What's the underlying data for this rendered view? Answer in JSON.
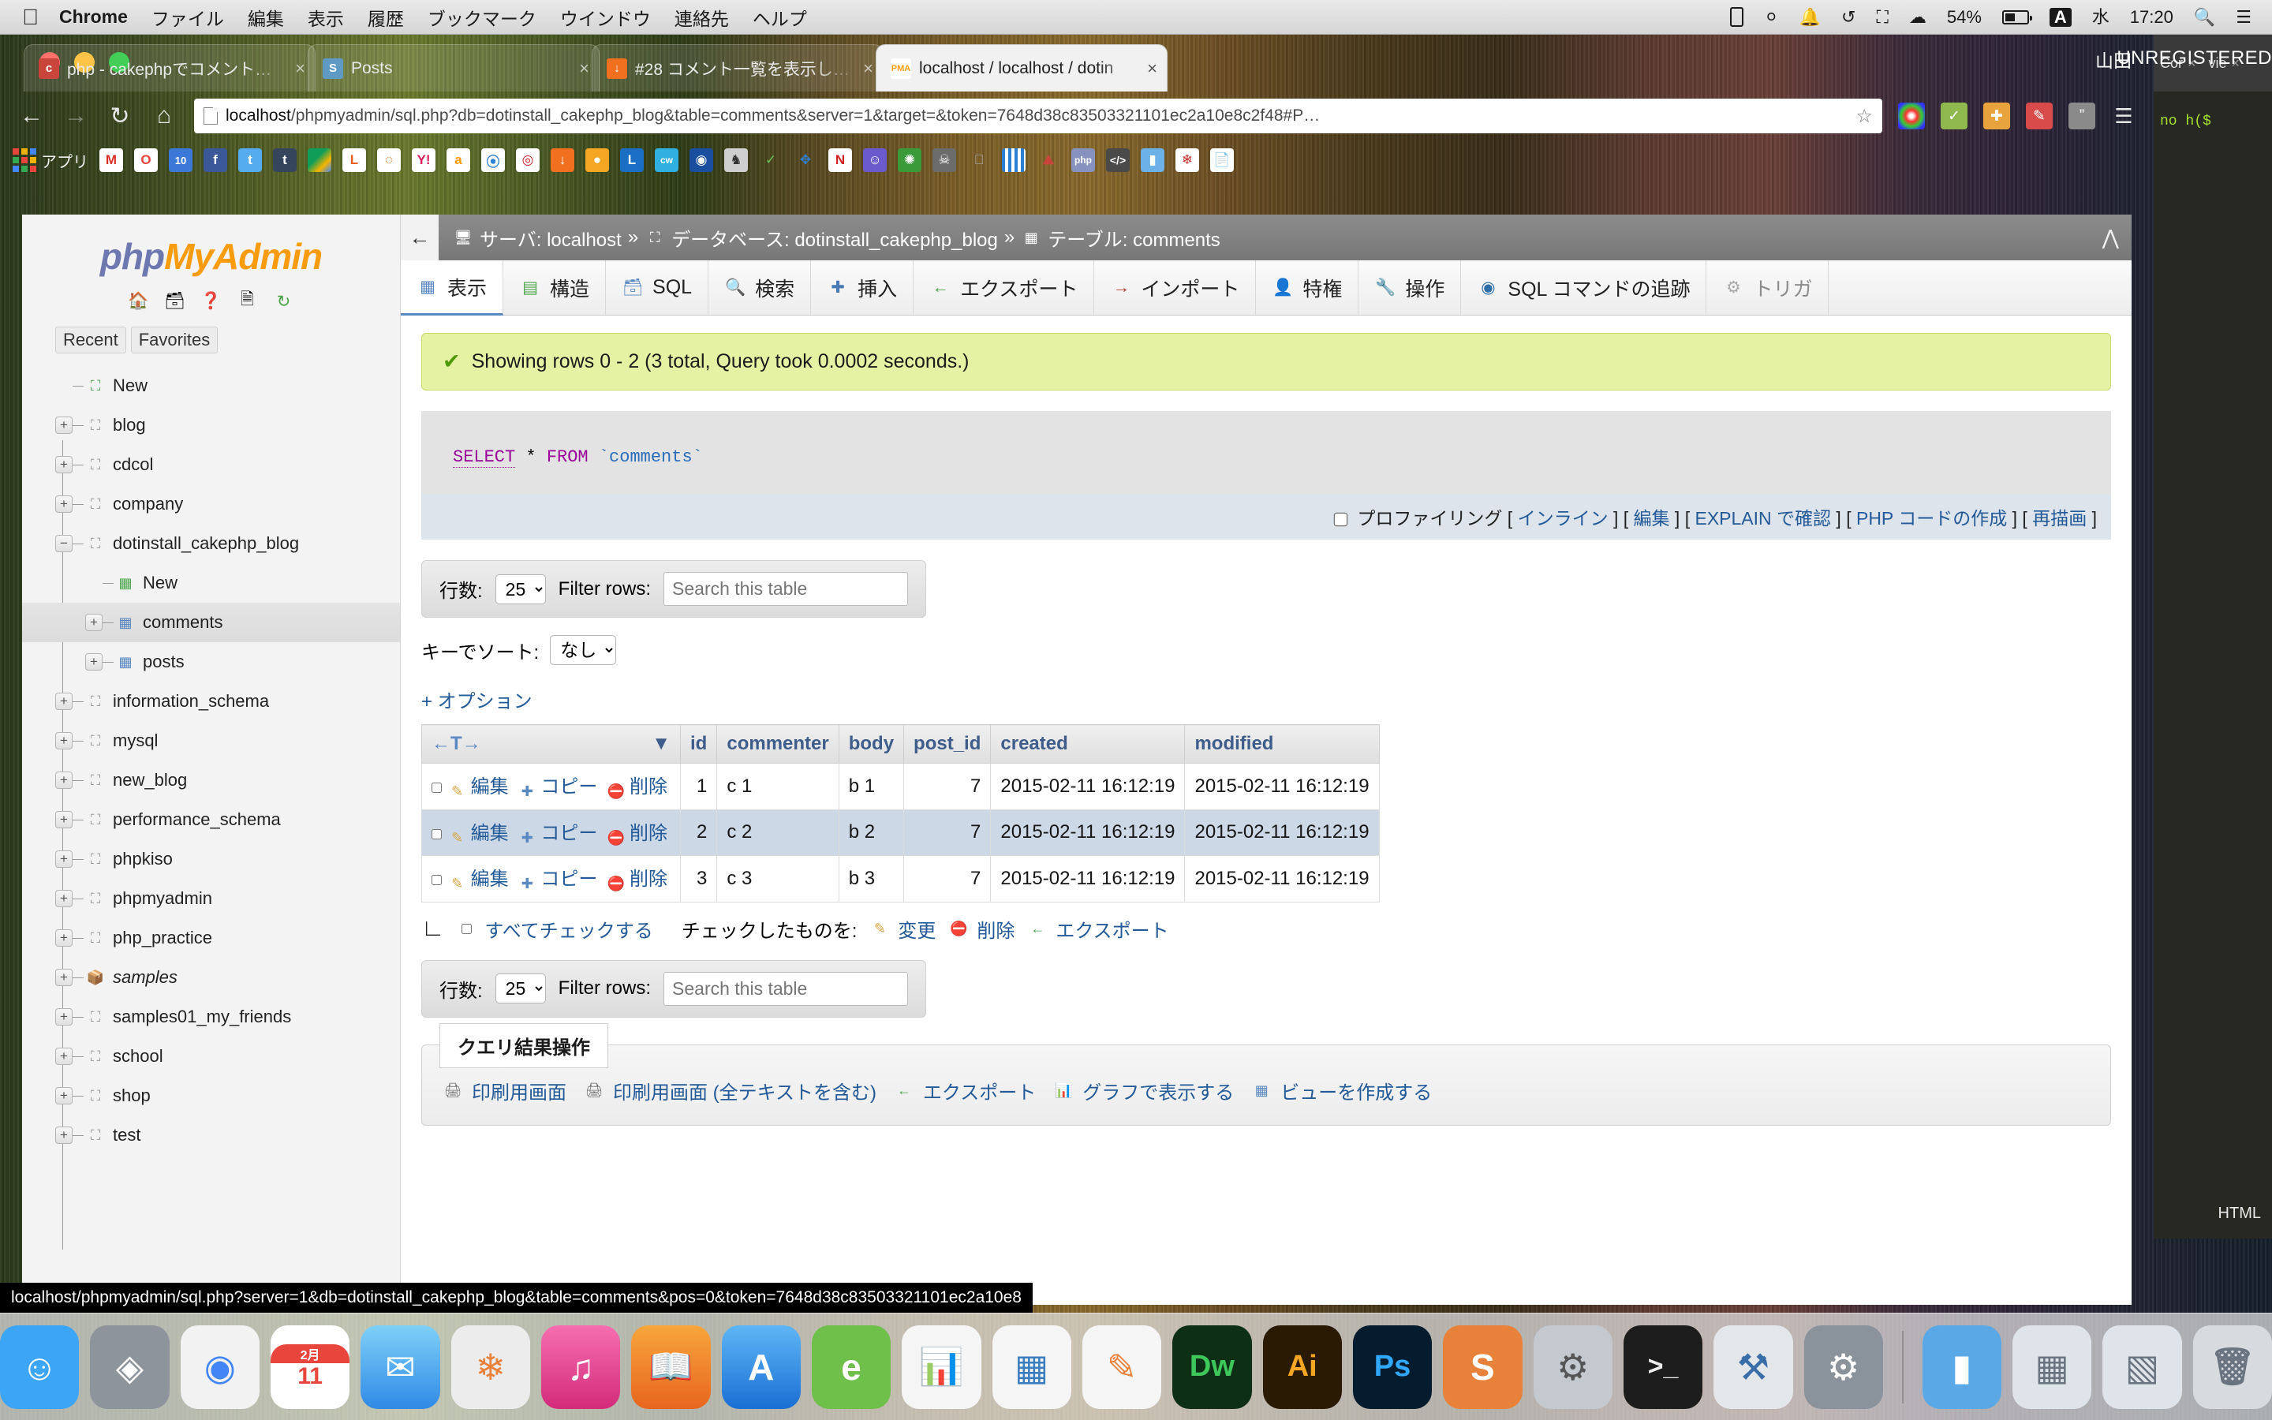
{
  "menubar": {
    "apple": "apple-logo",
    "items": [
      {
        "label": "Chrome",
        "bold": true
      },
      {
        "label": "ファイル",
        "bold": false
      },
      {
        "label": "編集",
        "bold": false
      },
      {
        "label": "表示",
        "bold": false
      },
      {
        "label": "履歴",
        "bold": false
      },
      {
        "label": "ブックマーク",
        "bold": false
      },
      {
        "label": "ウインドウ",
        "bold": false
      },
      {
        "label": "連絡先",
        "bold": false
      },
      {
        "label": "ヘルプ",
        "bold": false
      }
    ],
    "status": {
      "battery_percent": "54%",
      "input_source": "A",
      "day": "水",
      "time": "17:20"
    }
  },
  "browser": {
    "tabs": [
      {
        "title": "php - cakephpでコメント…",
        "favicon": "cakephp-icon",
        "active": false
      },
      {
        "title": "Posts",
        "favicon": "posts-icon",
        "active": false
      },
      {
        "title": "#28 コメント一覧を表示し…",
        "favicon": "dotinstall-icon",
        "active": false
      },
      {
        "title": "localhost / localhost / dotin",
        "favicon": "phpmyadmin-icon",
        "active": true
      }
    ],
    "nav": {
      "back": "back-icon",
      "forward": "forward-icon",
      "reload": "reload-icon",
      "home": "home-icon"
    },
    "omnibox": {
      "url_bold": "localhost",
      "url_rest": "/phpmyadmin/sql.php?db=dotinstall_cakephp_blog&table=comments&server=1&target=&token=7648d38c83503321101ec2a10e8c2f48#P…",
      "star": "star-icon"
    },
    "bookmarks": [
      {
        "label": "アプリ",
        "icon": "apps-grid-icon"
      },
      {
        "label": "",
        "icon": "gmail-icon"
      },
      {
        "label": "",
        "icon": "opera-icon"
      },
      {
        "label": "",
        "icon": "calendar-icon"
      },
      {
        "label": "",
        "icon": "facebook-icon"
      },
      {
        "label": "",
        "icon": "twitter-icon"
      },
      {
        "label": "",
        "icon": "tumblr-icon"
      },
      {
        "label": "",
        "icon": "google-drive-icon"
      },
      {
        "label": "",
        "icon": "livedoor-icon"
      },
      {
        "label": "",
        "icon": "firefox-icon"
      },
      {
        "label": "",
        "icon": "yahoo-icon"
      },
      {
        "label": "",
        "icon": "amazon-icon"
      },
      {
        "label": "",
        "icon": "water-icon"
      },
      {
        "label": "",
        "icon": "target-icon"
      },
      {
        "label": "",
        "icon": "download-icon"
      },
      {
        "label": "",
        "icon": "mango-icon"
      },
      {
        "label": "",
        "icon": "l-blue-icon"
      },
      {
        "label": "",
        "icon": "cw-icon"
      },
      {
        "label": "",
        "icon": "blue-circle-icon"
      },
      {
        "label": "",
        "icon": "horse-icon"
      },
      {
        "label": "",
        "icon": "check-icon"
      },
      {
        "label": "",
        "icon": "bluetooth-icon"
      },
      {
        "label": "",
        "icon": "n-icon"
      },
      {
        "label": "",
        "icon": "monkey-icon"
      },
      {
        "label": "",
        "icon": "leaf-icon"
      },
      {
        "label": "",
        "icon": "ghost-icon"
      },
      {
        "label": "",
        "icon": "apple-gray-icon"
      },
      {
        "label": "",
        "icon": "stripes-icon"
      },
      {
        "label": "",
        "icon": "cake-icon"
      },
      {
        "label": "",
        "icon": "php-icon"
      },
      {
        "label": "",
        "icon": "code-icon"
      },
      {
        "label": "",
        "icon": "folder-icon"
      },
      {
        "label": "",
        "icon": "seal-icon"
      },
      {
        "label": "",
        "icon": "doc-icon"
      }
    ],
    "extensions": [
      "color-wheel-icon",
      "check-green-icon",
      "orange-cross-icon",
      "pen-icon",
      "quote-icon",
      "chart-icon",
      "menu-icon"
    ],
    "status_bar_url": "localhost/phpmyadmin/sql.php?server=1&db=dotinstall_cakephp_blog&table=comments&pos=0&token=7648d38c83503321101ec2a10e8"
  },
  "pma": {
    "logo": {
      "part1": "php",
      "part2": "MyAdmin"
    },
    "nav_icons": [
      "home-icon",
      "sql-query-icon",
      "help-icon",
      "docs-icon",
      "reload-nav-icon"
    ],
    "nav_tabs": [
      {
        "label": "Recent"
      },
      {
        "label": "Favorites"
      }
    ],
    "db_tree": [
      {
        "label": "New",
        "expander": "none",
        "icon": "db-new-icon",
        "level": 0,
        "selected": false,
        "italic": false
      },
      {
        "label": "blog",
        "expander": "+",
        "icon": "db-icon",
        "level": 0,
        "selected": false,
        "italic": false
      },
      {
        "label": "cdcol",
        "expander": "+",
        "icon": "db-icon",
        "level": 0,
        "selected": false,
        "italic": false
      },
      {
        "label": "company",
        "expander": "+",
        "icon": "db-icon",
        "level": 0,
        "selected": false,
        "italic": false
      },
      {
        "label": "dotinstall_cakephp_blog",
        "expander": "-",
        "icon": "db-icon",
        "level": 0,
        "selected": false,
        "italic": false
      },
      {
        "label": "New",
        "expander": "none",
        "icon": "table-new-icon",
        "level": 1,
        "selected": false,
        "italic": false
      },
      {
        "label": "comments",
        "expander": "+",
        "icon": "table-icon",
        "level": 1,
        "selected": true,
        "italic": false
      },
      {
        "label": "posts",
        "expander": "+",
        "icon": "table-icon",
        "level": 1,
        "selected": false,
        "italic": false
      },
      {
        "label": "information_schema",
        "expander": "+",
        "icon": "db-icon",
        "level": 0,
        "selected": false,
        "italic": false
      },
      {
        "label": "mysql",
        "expander": "+",
        "icon": "db-icon",
        "level": 0,
        "selected": false,
        "italic": false
      },
      {
        "label": "new_blog",
        "expander": "+",
        "icon": "db-icon",
        "level": 0,
        "selected": false,
        "italic": false
      },
      {
        "label": "performance_schema",
        "expander": "+",
        "icon": "db-icon",
        "level": 0,
        "selected": false,
        "italic": false
      },
      {
        "label": "phpkiso",
        "expander": "+",
        "icon": "db-icon",
        "level": 0,
        "selected": false,
        "italic": false
      },
      {
        "label": "phpmyadmin",
        "expander": "+",
        "icon": "db-icon",
        "level": 0,
        "selected": false,
        "italic": false
      },
      {
        "label": "php_practice",
        "expander": "+",
        "icon": "db-icon",
        "level": 0,
        "selected": false,
        "italic": false
      },
      {
        "label": "samples",
        "expander": "+",
        "icon": "db-special-icon",
        "level": 0,
        "selected": false,
        "italic": true
      },
      {
        "label": "samples01_my_friends",
        "expander": "+",
        "icon": "db-icon",
        "level": 0,
        "selected": false,
        "italic": false
      },
      {
        "label": "school",
        "expander": "+",
        "icon": "db-icon",
        "level": 0,
        "selected": false,
        "italic": false
      },
      {
        "label": "shop",
        "expander": "+",
        "icon": "db-icon",
        "level": 0,
        "selected": false,
        "italic": false
      },
      {
        "label": "test",
        "expander": "+",
        "icon": "db-icon",
        "level": 0,
        "selected": false,
        "italic": false
      }
    ],
    "breadcrumb": {
      "back": "back-arrow-icon",
      "server_label": "サーバ: localhost",
      "db_label": "データベース: dotinstall_cakephp_blog",
      "table_label": "テーブル: comments",
      "sep": "»",
      "collapse": "collapse-icon"
    },
    "tabs": [
      {
        "label": "表示",
        "icon": "browse-icon",
        "active": true,
        "dim": false
      },
      {
        "label": "構造",
        "icon": "structure-icon",
        "active": false,
        "dim": false
      },
      {
        "label": "SQL",
        "icon": "sql-icon",
        "active": false,
        "dim": false
      },
      {
        "label": "検索",
        "icon": "search-icon",
        "active": false,
        "dim": false
      },
      {
        "label": "挿入",
        "icon": "insert-icon",
        "active": false,
        "dim": false
      },
      {
        "label": "エクスポート",
        "icon": "export-icon",
        "active": false,
        "dim": false
      },
      {
        "label": "インポート",
        "icon": "import-icon",
        "active": false,
        "dim": false
      },
      {
        "label": "特権",
        "icon": "privileges-icon",
        "active": false,
        "dim": false
      },
      {
        "label": "操作",
        "icon": "operations-icon",
        "active": false,
        "dim": false
      },
      {
        "label": "SQL コマンドの追跡",
        "icon": "tracking-icon",
        "active": false,
        "dim": false
      },
      {
        "label": "トリガ",
        "icon": "triggers-icon",
        "active": false,
        "dim": true
      }
    ],
    "result_message": "Showing rows 0 - 2 (3 total, Query took 0.0002 seconds.)",
    "sql": {
      "select": "SELECT",
      "star": "*",
      "from": "FROM",
      "table": "`comments`"
    },
    "sql_actions": {
      "profiling": "プロファイリング",
      "links": [
        "インライン",
        "編集",
        "EXPLAIN で確認",
        "PHP コードの作成",
        "再描画"
      ]
    },
    "rows_bar_top": {
      "rows_label": "行数:",
      "rows_value": "25",
      "filter_label": "Filter rows:",
      "filter_placeholder": "Search this table",
      "filter_value": ""
    },
    "sort_bar": {
      "label": "キーでソート:",
      "value": "なし"
    },
    "options_link": "+ オプション",
    "table": {
      "sort_col_icon": "sort-toggle-icon",
      "nav_icon": "←T→",
      "columns": [
        "id",
        "commenter",
        "body",
        "post_id",
        "created",
        "modified"
      ],
      "row_actions": [
        {
          "label": "編集",
          "icon": "edit-pencil-icon"
        },
        {
          "label": "コピー",
          "icon": "copy-icon"
        },
        {
          "label": "削除",
          "icon": "delete-icon"
        }
      ],
      "rows": [
        {
          "id": "1",
          "commenter": "c 1",
          "body": "b 1",
          "post_id": "7",
          "created": "2015-02-11 16:12:19",
          "modified": "2015-02-11 16:12:19"
        },
        {
          "id": "2",
          "commenter": "c 2",
          "body": "b 2",
          "post_id": "7",
          "created": "2015-02-11 16:12:19",
          "modified": "2015-02-11 16:12:19"
        },
        {
          "id": "3",
          "commenter": "c 3",
          "body": "b 3",
          "post_id": "7",
          "created": "2015-02-11 16:12:19",
          "modified": "2015-02-11 16:12:19"
        }
      ]
    },
    "check_bar": {
      "check_all": "すべてチェックする",
      "with_selected": "チェックしたものを:",
      "actions": [
        {
          "label": "変更",
          "icon": "edit-pencil-icon"
        },
        {
          "label": "削除",
          "icon": "delete-icon"
        },
        {
          "label": "エクスポート",
          "icon": "export-icon"
        }
      ]
    },
    "rows_bar_bottom": {
      "rows_label": "行数:",
      "rows_value": "25",
      "filter_label": "Filter rows:",
      "filter_placeholder": "Search this table",
      "filter_value": ""
    },
    "query_ops": {
      "legend": "クエリ結果操作",
      "links": [
        {
          "label": "印刷用画面",
          "icon": "print-icon"
        },
        {
          "label": "印刷用画面 (全テキストを含む)",
          "icon": "print-icon"
        },
        {
          "label": "エクスポート",
          "icon": "export-icon"
        },
        {
          "label": "グラフで表示する",
          "icon": "chart-bar-icon"
        },
        {
          "label": "ビューを作成する",
          "icon": "view-icon"
        }
      ]
    }
  },
  "editor": {
    "tabs": [
      {
        "label": "Cor"
      },
      {
        "label": "vie"
      }
    ],
    "code_snippet": "no  h($",
    "mode_label": "HTML",
    "unregistered": "UNREGISTERED",
    "user": "山田"
  },
  "dock": [
    {
      "name": "finder-icon",
      "glyph": "☺",
      "bg": "#3da5f5"
    },
    {
      "name": "launchpad-icon",
      "glyph": "🚀",
      "bg": "#6a6f78"
    },
    {
      "name": "chrome-icon",
      "glyph": "◉",
      "bg": "#f2f2f2"
    },
    {
      "name": "calendar-icon",
      "glyph": "11",
      "bg": "#ffffff"
    },
    {
      "name": "mail-icon",
      "glyph": "✉",
      "bg": "#4aa3f0"
    },
    {
      "name": "photos-icon",
      "glyph": "❀",
      "bg": "#e8e8e8"
    },
    {
      "name": "itunes-icon",
      "glyph": "♪",
      "bg": "#e94b9e"
    },
    {
      "name": "ibooks-icon",
      "glyph": "📖",
      "bg": "#f28b1e"
    },
    {
      "name": "appstore-icon",
      "glyph": "A",
      "bg": "#2f8ae6"
    },
    {
      "name": "evernote-icon",
      "glyph": "e",
      "bg": "#6fbf4b"
    },
    {
      "name": "numbers-icon",
      "glyph": "▦",
      "bg": "#f5f5f5"
    },
    {
      "name": "keynote-icon",
      "glyph": "▣",
      "bg": "#f5f5f5"
    },
    {
      "name": "pages-icon",
      "glyph": "✎",
      "bg": "#f5f5f5"
    },
    {
      "name": "dreamweaver-icon",
      "glyph": "Dw",
      "bg": "#27a03c"
    },
    {
      "name": "illustrator-icon",
      "glyph": "Ai",
      "bg": "#f5a623"
    },
    {
      "name": "photoshop-icon",
      "glyph": "Ps",
      "bg": "#1a3d5c"
    },
    {
      "name": "sublime-icon",
      "glyph": "S",
      "bg": "#e8813a"
    },
    {
      "name": "settings-icon",
      "glyph": "⚙",
      "bg": "#b9bec4"
    },
    {
      "name": "terminal-icon",
      "glyph": ">_",
      "bg": "#1d1d1d"
    },
    {
      "name": "xcode-icon",
      "glyph": "🔨",
      "bg": "#2f6fb5"
    },
    {
      "name": "utilities-icon",
      "glyph": "⚙",
      "bg": "#7c8691"
    },
    {
      "name": "folder-icon",
      "glyph": "▤",
      "bg": "#5aa9e6"
    },
    {
      "name": "documents-icon",
      "glyph": "▥",
      "bg": "#d8dde3"
    },
    {
      "name": "downloads-icon",
      "glyph": "▧",
      "bg": "#dfe4ea"
    },
    {
      "name": "trash-icon",
      "glyph": "🗑",
      "bg": "#d7dbdf"
    }
  ]
}
